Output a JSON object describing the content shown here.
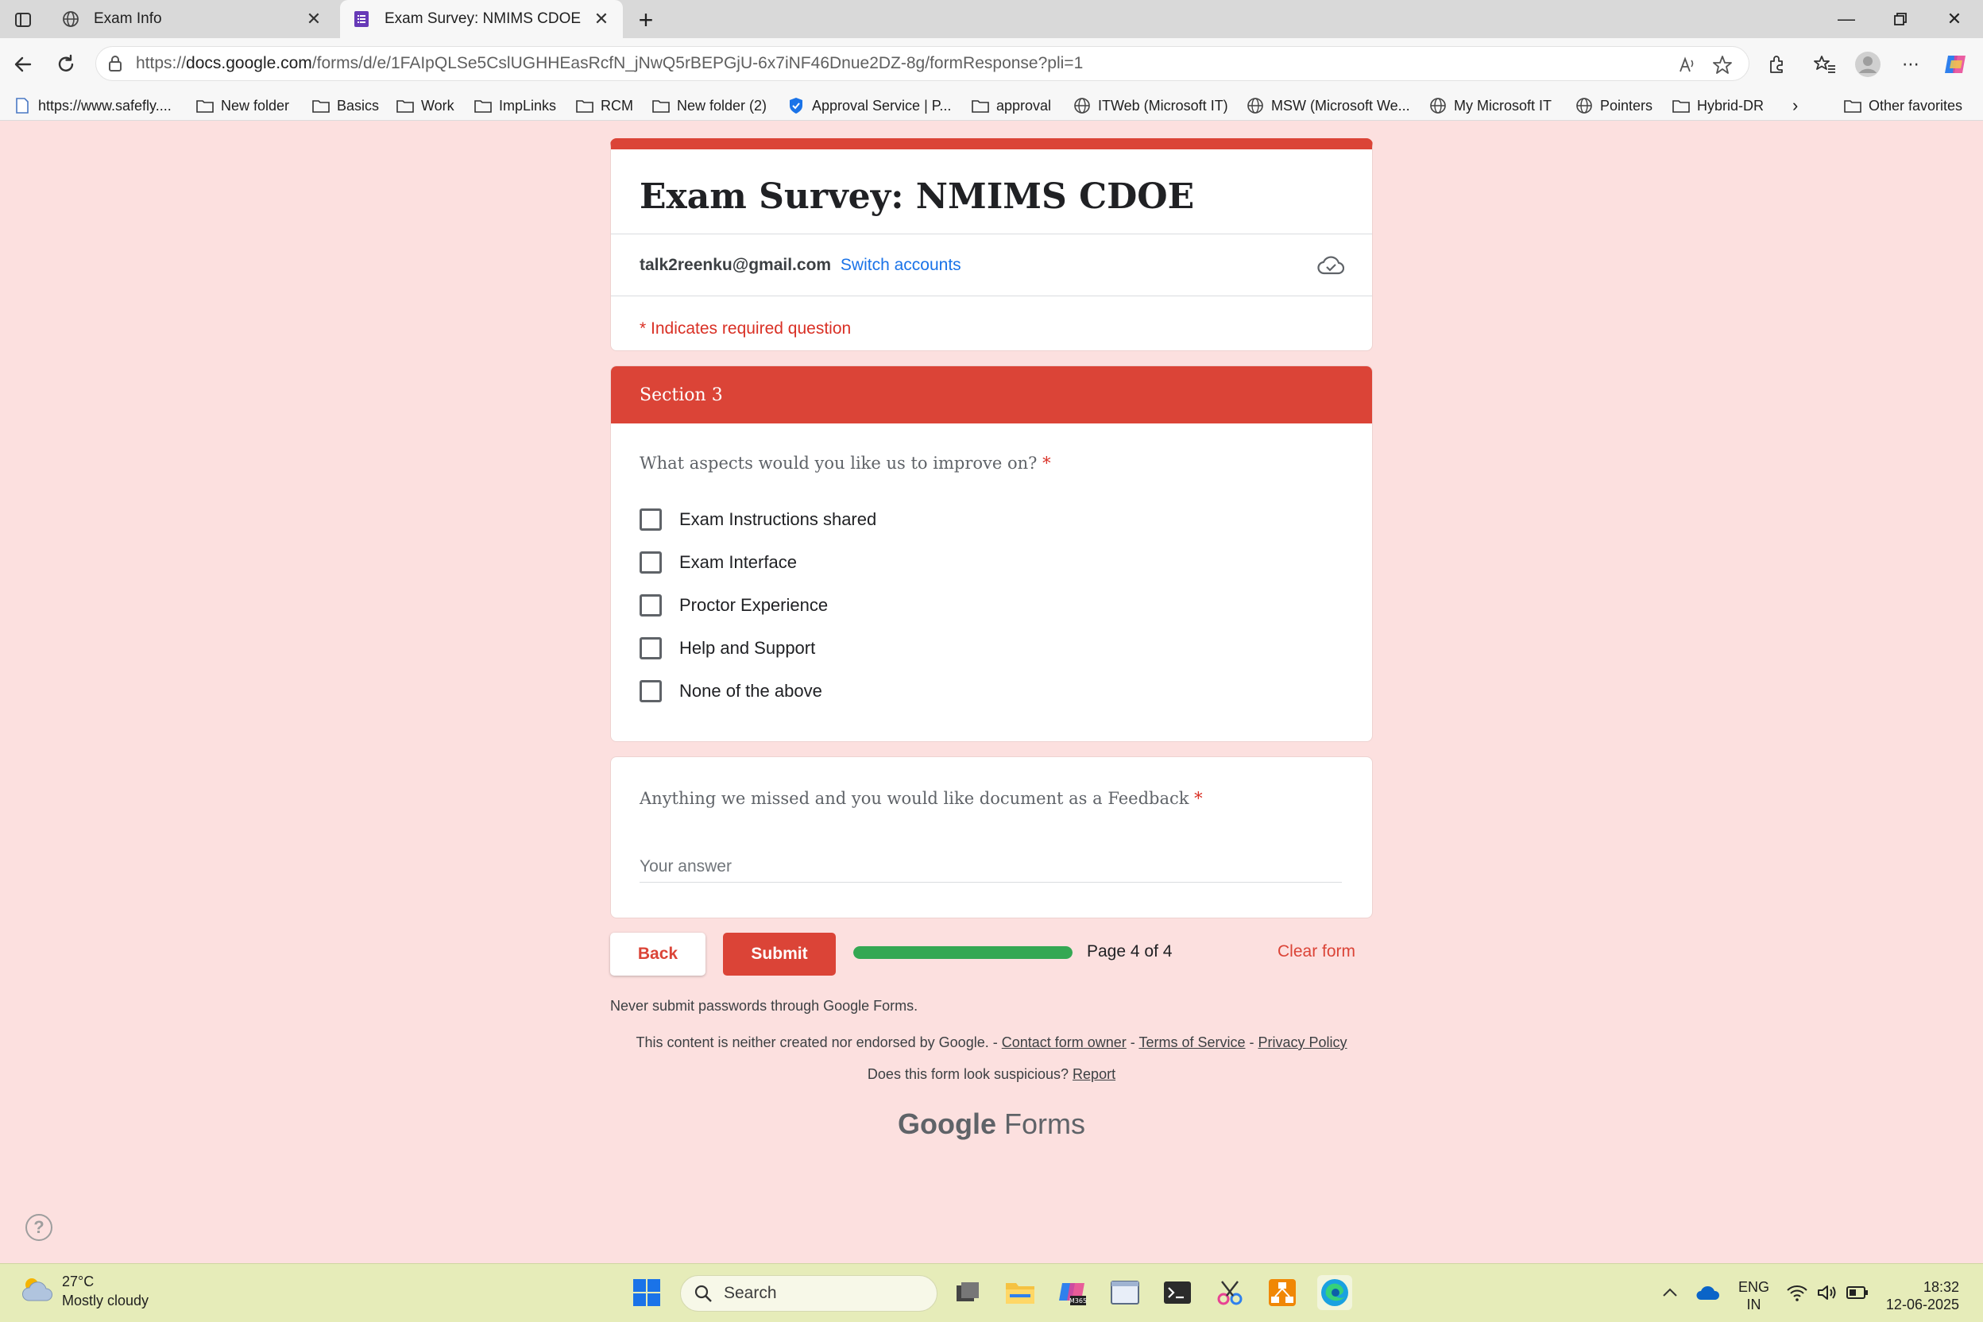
{
  "browser": {
    "tabs": [
      {
        "title": "Exam Info",
        "active": false
      },
      {
        "title": "Exam Survey: NMIMS CDOE",
        "active": true
      }
    ],
    "url_prefix": "https://",
    "url_host": "docs.google.com",
    "url_path": "/forms/d/e/1FAIpQLSe5CslUGHHEasRcfN_jNwQ5rBEPGjU-6x7iNF46Dnue2DZ-8g/formResponse?pli=1",
    "bookmarks": [
      {
        "label": "https://www.safefly....",
        "icon": "page-icon"
      },
      {
        "label": "New folder",
        "icon": "folder-icon"
      },
      {
        "label": "Basics",
        "icon": "folder-icon"
      },
      {
        "label": "Work",
        "icon": "folder-icon"
      },
      {
        "label": "ImpLinks",
        "icon": "folder-icon"
      },
      {
        "label": "RCM",
        "icon": "folder-icon"
      },
      {
        "label": "New folder (2)",
        "icon": "folder-icon"
      },
      {
        "label": "Approval Service | P...",
        "icon": "shield-icon"
      },
      {
        "label": "approval",
        "icon": "folder-icon"
      },
      {
        "label": "ITWeb (Microsoft IT)",
        "icon": "globe-icon"
      },
      {
        "label": "MSW (Microsoft We...",
        "icon": "globe-icon"
      },
      {
        "label": "My Microsoft IT",
        "icon": "globe-icon"
      },
      {
        "label": "Pointers",
        "icon": "globe-icon"
      },
      {
        "label": "Hybrid-DR",
        "icon": "folder-icon"
      }
    ],
    "other_favorites": "Other favorites"
  },
  "form": {
    "title": "Exam Survey: NMIMS CDOE",
    "email": "talk2reenku@gmail.com",
    "switch_accounts": "Switch accounts",
    "required_note": "* Indicates required question",
    "section_title": "Section 3",
    "q1": {
      "text": "What aspects would you like us to improve on?",
      "required_mark": "*",
      "options": [
        "Exam Instructions shared",
        "Exam Interface",
        "Proctor Experience",
        "Help and Support",
        "None of the above"
      ]
    },
    "q2": {
      "text": "Anything we missed and you would like document as a Feedback",
      "required_mark": "*",
      "placeholder": "Your answer"
    },
    "back_label": "Back",
    "submit_label": "Submit",
    "progress_fraction": 1.0,
    "page_indicator": "Page 4 of 4",
    "clear_label": "Clear form",
    "never_submit": "Never submit passwords through Google Forms.",
    "disclaimer_text": "This content is neither created nor endorsed by Google. -",
    "contact_owner": "Contact form owner",
    "terms": "Terms of Service",
    "privacy": "Privacy Policy",
    "suspicious_text": "Does this form look suspicious?",
    "report": "Report",
    "logo_google": "Google",
    "logo_forms": "Forms"
  },
  "taskbar": {
    "temperature": "27°C",
    "weather": "Mostly cloudy",
    "search_placeholder": "Search",
    "lang": "ENG",
    "region": "IN",
    "time": "18:32",
    "date": "12-06-2025"
  },
  "colors": {
    "accent": "#db4437",
    "page_bg": "#fce0df",
    "progress": "#34a853",
    "link": "#1a73e8"
  }
}
